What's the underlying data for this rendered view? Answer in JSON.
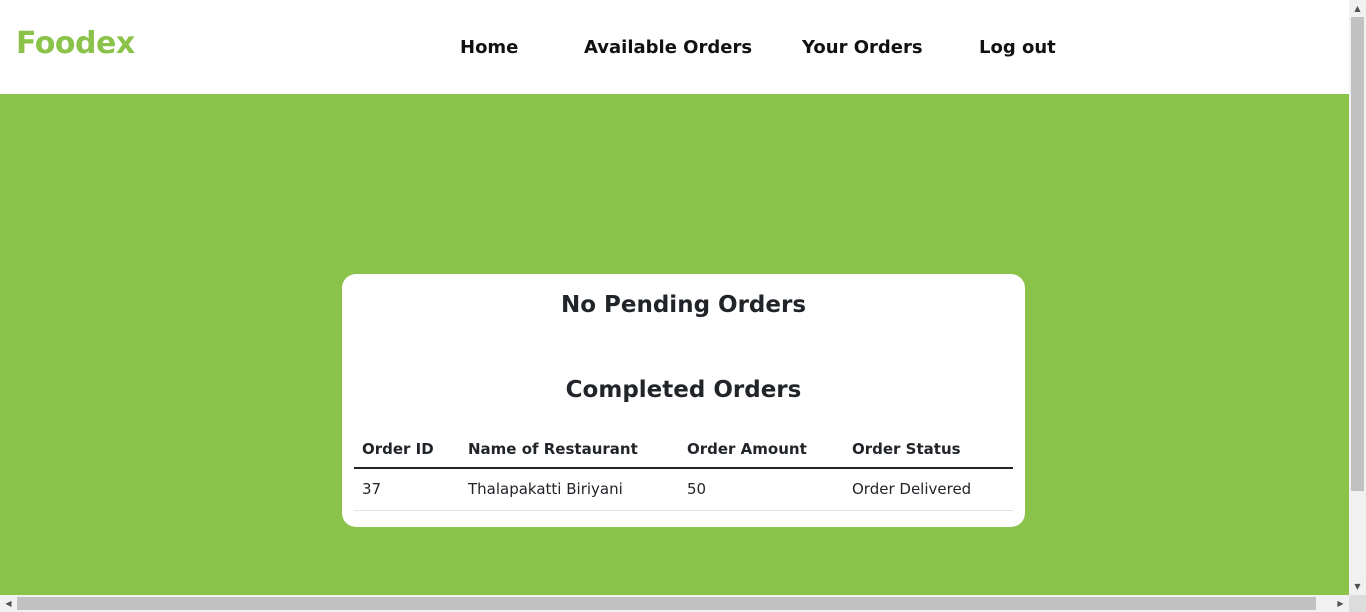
{
  "brand": {
    "name": "Foodex",
    "color": "#8bc34a"
  },
  "nav": {
    "items": [
      {
        "label": "Home"
      },
      {
        "label": "Available Orders"
      },
      {
        "label": "Your Orders"
      },
      {
        "label": "Log out"
      }
    ]
  },
  "main": {
    "background": "#8bc34a",
    "pending_heading": "No Pending Orders",
    "completed_heading": "Completed Orders",
    "table": {
      "columns": [
        "Order ID",
        "Name of Restaurant",
        "Order Amount",
        "Order Status"
      ],
      "rows": [
        [
          "37",
          "Thalapakatti Biriyani",
          "50",
          "Order Delivered"
        ]
      ]
    }
  }
}
